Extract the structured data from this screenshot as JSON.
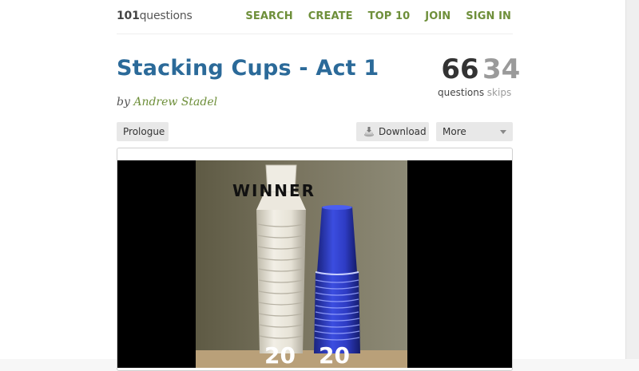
{
  "header": {
    "logo_bold": "101",
    "logo_rest": "questions",
    "nav": [
      "SEARCH",
      "CREATE",
      "TOP 10",
      "JOIN",
      "SIGN IN"
    ]
  },
  "question": {
    "title": "Stacking Cups - Act 1",
    "by": "by",
    "author": "Andrew Stadel"
  },
  "stats": {
    "questions_count": "66",
    "questions_label": "questions",
    "skips_count": "34",
    "skips_label": "skips"
  },
  "toolbar": {
    "prologue": "Prologue",
    "download": "Download",
    "more": "More"
  },
  "media": {
    "winner_text": "WINNER",
    "count_left": "20",
    "count_right": "20"
  },
  "colors": {
    "brand_green": "#6e8f3a",
    "title_blue": "#2b6a99",
    "cup_blue": "#2f3fc4"
  }
}
